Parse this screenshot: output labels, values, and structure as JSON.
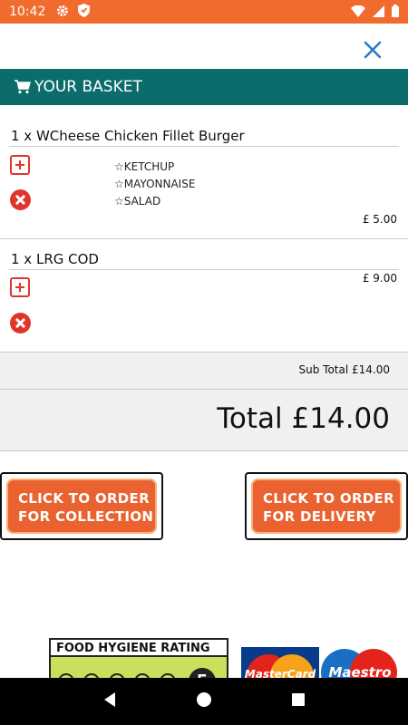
{
  "status_bar": {
    "time": "10:42",
    "bg": "#f26b2e"
  },
  "header": {
    "title": "YOUR BASKET",
    "icon": "cart-icon",
    "bg": "#0c6c6c"
  },
  "items": [
    {
      "title": "1 x WCheese Chicken Fillet Burger",
      "options": [
        "☆KETCHUP",
        "☆MAYONNAISE",
        "☆SALAD"
      ],
      "price": "£ 5.00"
    },
    {
      "title": "1 x LRG COD",
      "options": [],
      "price": "£ 9.00"
    }
  ],
  "totals": {
    "subtotal": "Sub Total £14.00",
    "total": "Total £14.00"
  },
  "buttons": {
    "collection_line1": "CLICK TO ORDER",
    "collection_line2": "FOR COLLECTION",
    "delivery_line1": "CLICK TO ORDER",
    "delivery_line2": "FOR DELIVERY"
  },
  "footer": {
    "hygiene_title": "FOOD HYGIENE RATING",
    "hygiene_score": "5",
    "mastercard": "MasterCard",
    "maestro": "Maestro"
  },
  "colors": {
    "accent": "#e9622f",
    "remove": "#e0352b"
  }
}
